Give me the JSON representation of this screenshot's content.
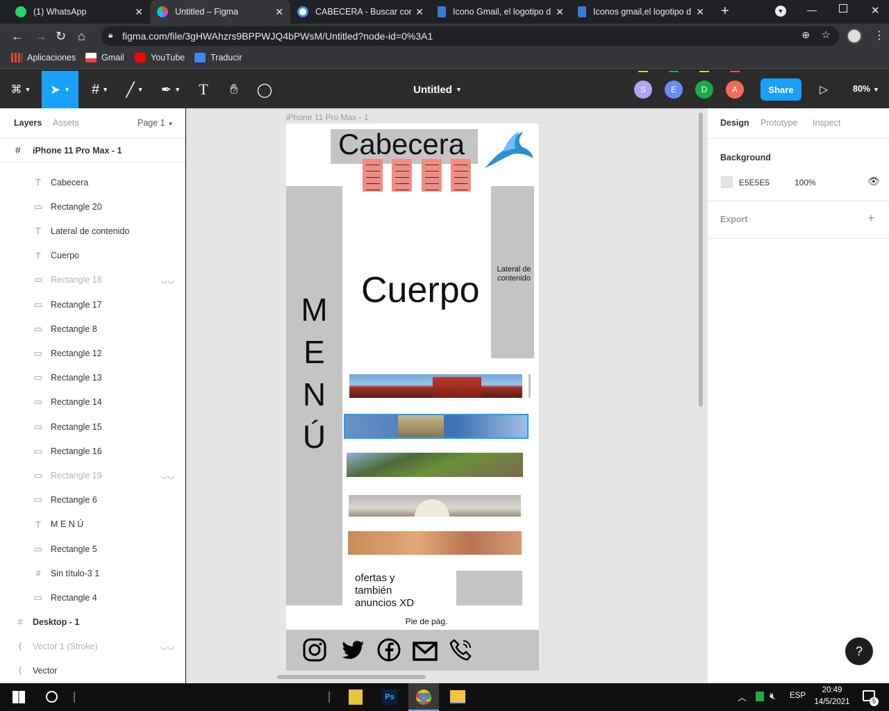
{
  "browser": {
    "tabs": [
      {
        "label": "(1) WhatsApp",
        "active": false,
        "color": "#25d366"
      },
      {
        "label": "Untitled – Figma",
        "active": true,
        "color": "#a259ff"
      },
      {
        "label": "CABECERA - Buscar con G",
        "active": false,
        "color": "#4285f4"
      },
      {
        "label": "Icono Gmail, el logotipo d",
        "active": false,
        "color": "#3a7bd5"
      },
      {
        "label": "Iconos gmail,el logotipo d",
        "active": false,
        "color": "#3a7bd5"
      }
    ],
    "url": "figma.com/file/3gHWAhzrs9BPPWJQ4bPWsM/Untitled?node-id=0%3A1",
    "bookmarks": [
      {
        "label": "Aplicaciones",
        "color": "#ea4335"
      },
      {
        "label": "Gmail",
        "color": "#ea4335"
      },
      {
        "label": "YouTube",
        "color": "#ff0000"
      },
      {
        "label": "Traducir",
        "color": "#4285f4"
      }
    ]
  },
  "figma": {
    "file_title": "Untitled",
    "share_label": "Share",
    "zoom": "80%",
    "collaborators": [
      {
        "initial": "S",
        "color": "#b3a3f4"
      },
      {
        "initial": "E",
        "color": "#6b8cf5"
      },
      {
        "initial": "D",
        "color": "#1bab45"
      },
      {
        "initial": "A",
        "color": "#f26b5a"
      }
    ],
    "collab_bar_colors": [
      "#f2c94c",
      "#27ae60",
      "#f2c94c",
      "#eb5757"
    ]
  },
  "left_panel": {
    "tabs": [
      "Layers",
      "Assets"
    ],
    "page": "Page 1",
    "frame_name": "iPhone 11 Pro Max - 1",
    "layers": [
      {
        "icon": "text",
        "name": "Cabecera",
        "hidden": false
      },
      {
        "icon": "rect",
        "name": "Rectangle 20",
        "hidden": false
      },
      {
        "icon": "text",
        "name": "Lateral de contenido",
        "hidden": false
      },
      {
        "icon": "text",
        "name": "Cuerpo",
        "hidden": false
      },
      {
        "icon": "rect",
        "name": "Rectangle 18",
        "hidden": true
      },
      {
        "icon": "rect",
        "name": "Rectangle 17",
        "hidden": false
      },
      {
        "icon": "rect",
        "name": "Rectangle 8",
        "hidden": false
      },
      {
        "icon": "rect",
        "name": "Rectangle 12",
        "hidden": false
      },
      {
        "icon": "rect",
        "name": "Rectangle 13",
        "hidden": false
      },
      {
        "icon": "rect",
        "name": "Rectangle 14",
        "hidden": false
      },
      {
        "icon": "rect",
        "name": "Rectangle 15",
        "hidden": false
      },
      {
        "icon": "rect",
        "name": "Rectangle 16",
        "hidden": false
      },
      {
        "icon": "rect",
        "name": "Rectangle 19",
        "hidden": true
      },
      {
        "icon": "rect",
        "name": "Rectangle 6",
        "hidden": false
      },
      {
        "icon": "text",
        "name": "M E N Ú",
        "hidden": false
      },
      {
        "icon": "rect",
        "name": "Rectangle 5",
        "hidden": false
      },
      {
        "icon": "frame",
        "name": "Sin título-3 1",
        "hidden": false
      },
      {
        "icon": "rect",
        "name": "Rectangle 4",
        "hidden": false
      }
    ],
    "top_level": [
      {
        "icon": "frame",
        "name": "Desktop - 1",
        "hidden": false
      },
      {
        "icon": "vector",
        "name": "Vector 1 (Stroke)",
        "hidden": true
      },
      {
        "icon": "vector",
        "name": "Vector",
        "hidden": false
      }
    ]
  },
  "canvas": {
    "frame_label": "iPhone 11 Pro Max - 1",
    "header_text": "Cabecera",
    "body_text": "Cuerpo",
    "side_text": "Lateral de contenido",
    "menu_letters": [
      "M",
      "E",
      "N",
      "Ú"
    ],
    "offers_text": "ofertas y también anuncios XD",
    "footer_text": "Pie de pág.",
    "social_icons": [
      "instagram-icon",
      "twitter-icon",
      "facebook-icon",
      "mail-icon",
      "phone-icon"
    ]
  },
  "right_panel": {
    "tabs": [
      "Design",
      "Prototype",
      "Inspect"
    ],
    "background_label": "Background",
    "bg_color_hex": "E5E5E5",
    "bg_swatch": "#e5e5e5",
    "bg_opacity": "100%",
    "export_label": "Export"
  },
  "taskbar": {
    "lang": "ESP",
    "time": "20:49",
    "date": "14/5/2021",
    "notifications": "5"
  },
  "help_label": "?"
}
